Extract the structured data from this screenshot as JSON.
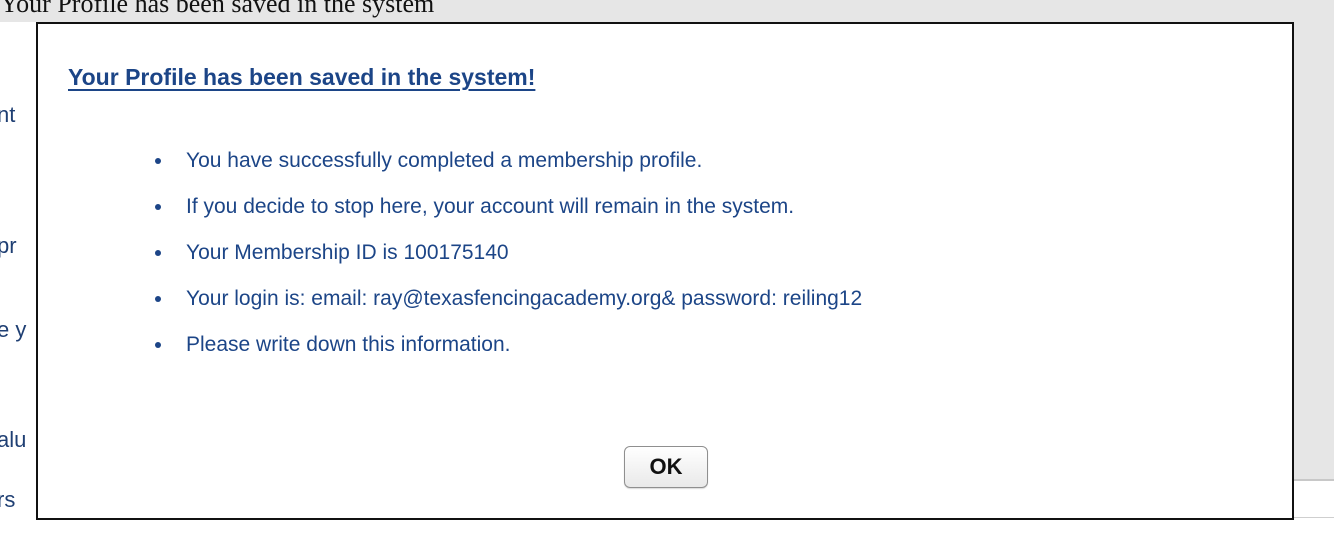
{
  "background": {
    "top_text": "Your Profile has been saved in the system",
    "fragments": [
      "nt",
      "pr",
      "e y",
      "alu",
      "rs"
    ]
  },
  "dialog": {
    "title": "Your Profile has been saved in the system!",
    "items": [
      "You have successfully completed a membership profile.",
      "If you decide to stop here, your account will remain in the system.",
      "Your Membership ID is 100175140",
      "Your login is: email: ray@texasfencingacademy.org& password: reiling12",
      "Please write down this information."
    ],
    "ok_label": "OK"
  },
  "colors": {
    "accent": "#1c4587",
    "page_background": "#e6e6e6",
    "dialog_background": "#ffffff",
    "dialog_border": "#111111"
  }
}
